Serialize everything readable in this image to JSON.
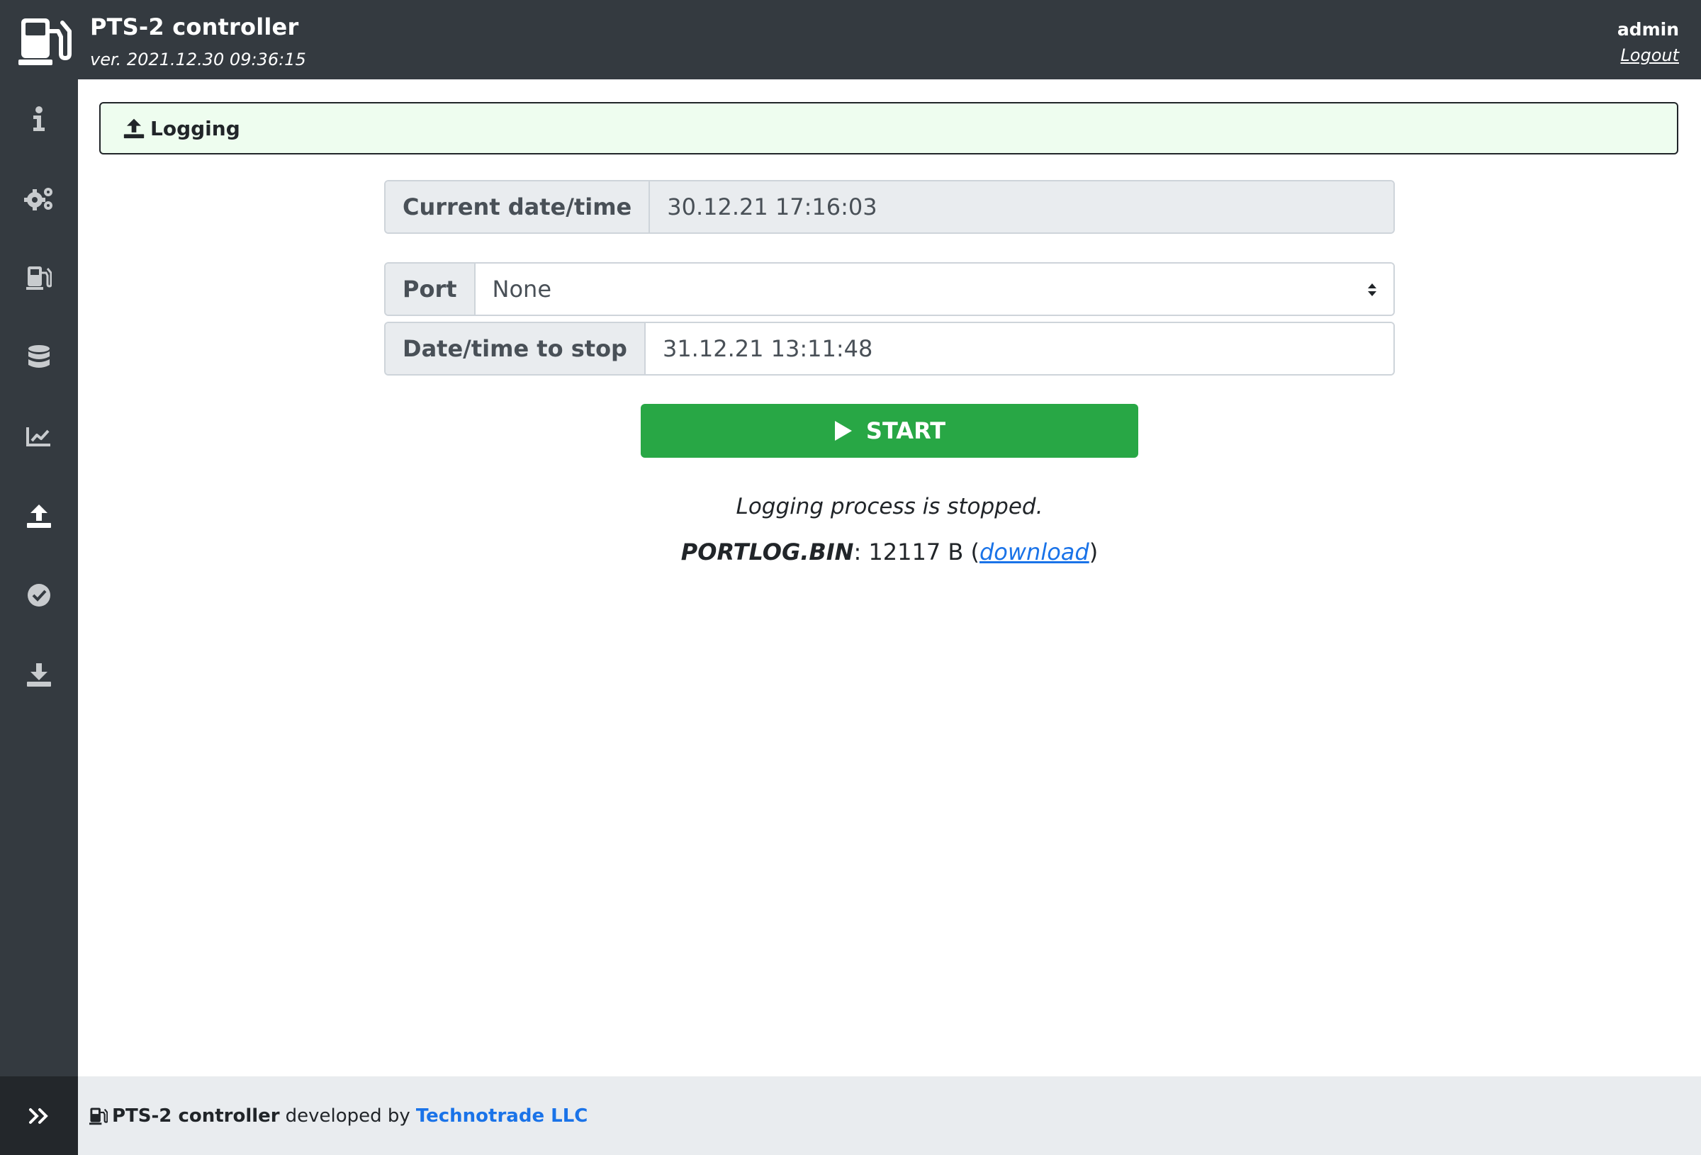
{
  "header": {
    "title": "PTS-2 controller",
    "version": "ver. 2021.12.30 09:36:15",
    "user": "admin",
    "logout_label": "Logout",
    "logo_icon": "fuel-pump-icon"
  },
  "sidebar": {
    "items": [
      {
        "icon": "info-icon"
      },
      {
        "icon": "gears-icon"
      },
      {
        "icon": "fuel-pump-icon"
      },
      {
        "icon": "database-icon"
      },
      {
        "icon": "chart-line-icon"
      },
      {
        "icon": "upload-icon",
        "active": true
      },
      {
        "icon": "check-circle-icon"
      },
      {
        "icon": "download-icon"
      }
    ],
    "toggle_icon": "double-chevron-right-icon"
  },
  "section": {
    "icon": "upload-icon",
    "title": "Logging"
  },
  "form": {
    "current_datetime_label": "Current date/time",
    "current_datetime_value": "30.12.21 17:16:03",
    "port_label": "Port",
    "port_value": "None",
    "stop_label": "Date/time to stop",
    "stop_value": "31.12.21 13:11:48"
  },
  "start_button": {
    "label": "START",
    "icon": "play-icon"
  },
  "status": {
    "message": "Logging process is stopped.",
    "file_name": "PORTLOG.BIN",
    "file_size": "12117 B",
    "download_label": "download"
  },
  "footer": {
    "brand": "PTS-2 controller",
    "text": "developed by",
    "company": "Technotrade LLC"
  },
  "colors": {
    "dark": "#343a40",
    "success": "#28a745",
    "link": "#1a73e8",
    "header_bg": "#eefdef"
  }
}
